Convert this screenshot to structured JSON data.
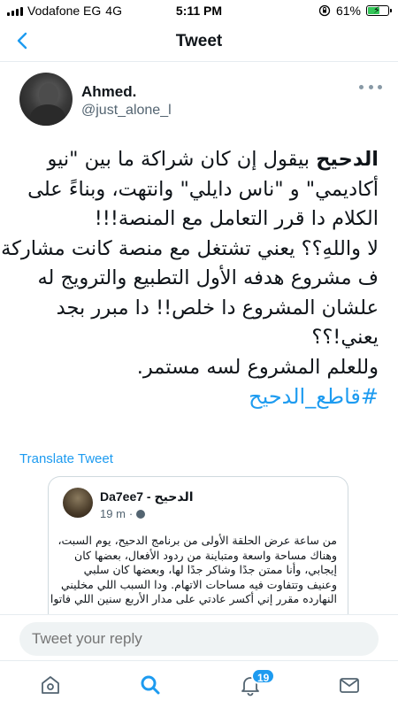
{
  "status_bar": {
    "carrier": "Vodafone EG",
    "network": "4G",
    "time": "5:11 PM",
    "battery_percent": "61%",
    "battery_level": 0.61
  },
  "header": {
    "title": "Tweet"
  },
  "tweet": {
    "author_name": "Ahmed.",
    "author_handle": "@just_alone_l",
    "lines": [
      {
        "bold": "الدحيح",
        "text": " بيقول إن كان شراكة ما بين \"نيو"
      },
      {
        "bold": "",
        "text": "أكاديمي\" و \"ناس دايلي\" وانتهت، وبناءً على"
      },
      {
        "bold": "",
        "text": "الكلام دا قرر التعامل مع المنصة!!!"
      },
      {
        "bold": "",
        "text": "لا واللهِ؟؟ يعني تشتغل مع منصة كانت مشاركة"
      },
      {
        "bold": "",
        "text": "ف مشروع هدفه الأول التطبيع والترويج له"
      },
      {
        "bold": "",
        "text": "علشان المشروع دا خلص!! دا مبرر بجد"
      },
      {
        "bold": "",
        "text": "يعني!؟؟"
      },
      {
        "bold": "",
        "text": "وللعلم المشروع لسه مستمر."
      }
    ],
    "hashtag": "#قاطع_الدحيح",
    "translate_label": "Translate Tweet"
  },
  "quoted_tweet": {
    "name": "Da7ee7 - الدحيح",
    "time": "19 m",
    "lines": [
      "من ساعة عرض الحلقة الأولى من برنامج الدحيح، يوم السبت،",
      "وهناك مساحة واسعة ومتباينة من ردود الأفعال، بعضها كان",
      "إيجابي، وأنا ممتن جدًا وشاكر جدًا لها، وبعضها كان سلبي",
      "وعنيف وتتفاوت فيه مساحات الاتهام. ودا السبب اللي مخليني",
      "النهارده مقرر إني أكسر عادتي على مدار الأربع سنين اللي فاتوا"
    ]
  },
  "reply": {
    "placeholder": "Tweet your reply"
  },
  "tabbar": {
    "items": [
      "home-icon",
      "search-icon",
      "notifications-icon",
      "messages-icon"
    ],
    "notification_count": "19"
  },
  "colors": {
    "accent": "#1d9bf0",
    "text": "#0f1419",
    "muted": "#536471",
    "battery": "#34c759"
  }
}
